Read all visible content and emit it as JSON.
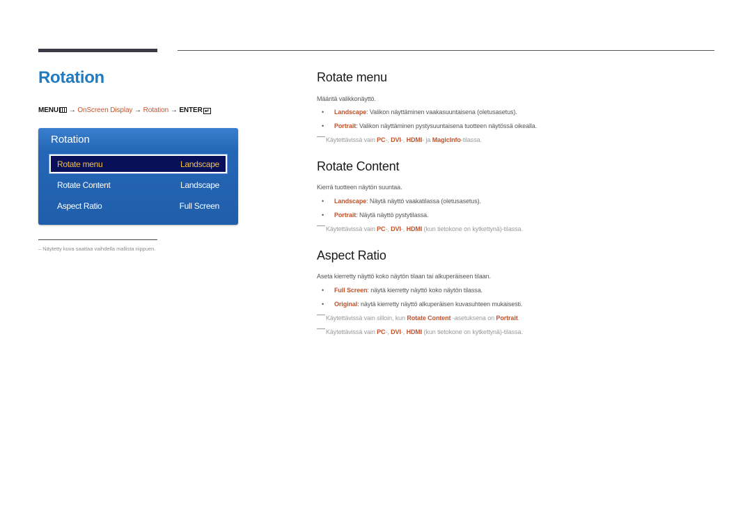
{
  "page": {
    "title": "Rotation"
  },
  "breadcrumb": {
    "menu": "MENU",
    "arrow": "→",
    "step1": "OnScreen Display",
    "step2": "Rotation",
    "enter": "ENTER",
    "menu_icon": "menu-grid-icon",
    "enter_icon": "enter-icon"
  },
  "osd": {
    "title": "Rotation",
    "rows": [
      {
        "label": "Rotate menu",
        "value": "Landscape",
        "selected": true
      },
      {
        "label": "Rotate Content",
        "value": "Landscape",
        "selected": false
      },
      {
        "label": "Aspect Ratio",
        "value": "Full Screen",
        "selected": false
      }
    ],
    "colors": {
      "panel": "#2466b6",
      "selected_bg": "#0a0f5a",
      "selected_text": "#f2c23a"
    }
  },
  "footnote": "–  Näytetty kuva saattaa vaihdella mallista riippuen.",
  "sections": {
    "rotate_menu": {
      "heading": "Rotate menu",
      "description": "Määritä valikkonäyttö.",
      "bullets": [
        {
          "term": "Landscape",
          "text": ": Valikon näyttäminen vaakasuuntaisena (oletusasetus)."
        },
        {
          "term": "Portrait",
          "text": ": Valikon näyttäminen pystysuuntaisena tuotteen näytössä oikealla."
        }
      ],
      "note": {
        "pre": "Käytettävissä vain ",
        "t1": "PC",
        "s1": "-, ",
        "t2": "DVI",
        "s2": "-, ",
        "t3": "HDMI",
        "s3": "- ja ",
        "t4": "MagicInfo",
        "s4": "-tilassa."
      }
    },
    "rotate_content": {
      "heading": "Rotate Content",
      "description": "Kierrä tuotteen näytön suuntaa.",
      "bullets": [
        {
          "term": "Landscape",
          "text": ": Näytä näyttö vaakatilassa (oletusasetus)."
        },
        {
          "term": "Portrait",
          "text": ": Näytä näyttö pystytilassa."
        }
      ],
      "note": {
        "pre": "Käytettävissä vain ",
        "t1": "PC",
        "s1": "-, ",
        "t2": "DVI",
        "s2": "-, ",
        "t3": "HDMI",
        "s3": " (kun tietokone on kytkettynä)-tilassa."
      }
    },
    "aspect_ratio": {
      "heading": "Aspect Ratio",
      "description": "Aseta kierretty näyttö koko näytön tilaan tai alkuperäiseen tilaan.",
      "bullets": [
        {
          "term": "Full Screen",
          "text": ": näytä kierretty näyttö koko näytön tilassa."
        },
        {
          "term": "Original",
          "text": ": näytä kierretty näyttö alkuperäisen kuvasuhteen mukaisesti."
        }
      ],
      "note1": {
        "pre": "Käytettävissä vain silloin, kun ",
        "t1": "Rotate Content",
        "s1": " -asetuksena on ",
        "t2": "Portrait",
        "s2": "."
      },
      "note2": {
        "pre": "Käytettävissä vain ",
        "t1": "PC",
        "s1": "-, ",
        "t2": "DVI",
        "s2": "-, ",
        "t3": "HDMI",
        "s3": " (kun tietokone on kytkettynä)-tilassa."
      }
    }
  },
  "bullet_char": "•",
  "colors": {
    "title": "#1f7bc2",
    "highlight": "#c4522a",
    "note": "#9a9a9a"
  }
}
